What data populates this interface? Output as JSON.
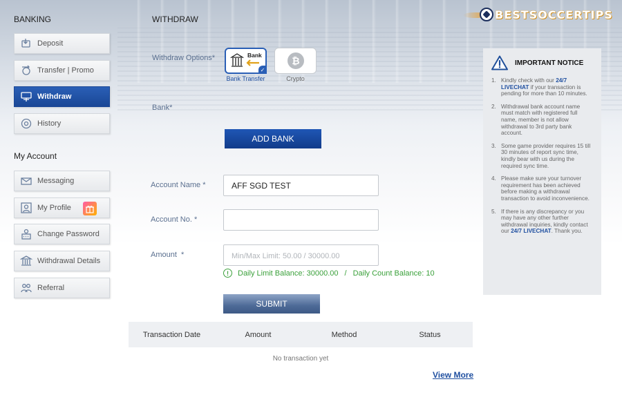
{
  "sidebar": {
    "banking_title": "BANKING",
    "banking_items": [
      {
        "label": "Deposit",
        "icon": "deposit-icon"
      },
      {
        "label": "Transfer | Promo",
        "icon": "transfer-icon"
      },
      {
        "label": "Withdraw",
        "icon": "withdraw-icon",
        "active": true
      },
      {
        "label": "History",
        "icon": "history-icon"
      }
    ],
    "account_title": "My Account",
    "account_items": [
      {
        "label": "Messaging",
        "icon": "envelope-icon"
      },
      {
        "label": "My Profile",
        "icon": "profile-icon",
        "badge": "gift-icon"
      },
      {
        "label": "Change Password",
        "icon": "password-icon"
      },
      {
        "label": "Withdrawal Details",
        "icon": "bank-icon"
      },
      {
        "label": "Referral",
        "icon": "referral-icon"
      }
    ]
  },
  "header": {
    "title": "WITHDRAW",
    "logo_text": "BESTSOCCERTIPS"
  },
  "form": {
    "withdraw_options_label": "Withdraw Options*",
    "options": [
      {
        "label": "Bank Transfer",
        "box_text": "Bank",
        "selected": true
      },
      {
        "label": "Crypto",
        "selected": false
      }
    ],
    "bank_label": "Bank*",
    "add_bank_label": "ADD BANK",
    "account_name_label": "Account Name *",
    "account_name_value": "AFF SGD TEST",
    "account_no_label": "Account No. *",
    "account_no_value": "",
    "amount_label": "Amount  *",
    "amount_placeholder": "Min/Max Limit: 50.00 / 30000.00",
    "daily_limit": "Daily Limit Balance: 30000.00",
    "separator": "/",
    "daily_count": "Daily Count Balance: 10",
    "submit_label": "SUBMIT"
  },
  "transactions": {
    "columns": [
      "Transaction Date",
      "Amount",
      "Method",
      "Status"
    ],
    "empty_text": "No transaction yet",
    "view_more": "View More"
  },
  "notice": {
    "title": "IMPORTANT NOTICE",
    "items": [
      {
        "num": "1.",
        "pre": "Kindly check with our ",
        "link": "24/7 LIVECHAT",
        "post": " if your transaction is pending for more than 10 minutes."
      },
      {
        "num": "2.",
        "text": "Withdrawal bank account name must match with registered full name, member is not allow withdrawal to 3rd party bank account."
      },
      {
        "num": "3.",
        "text": "Some game provider requires 15 till 30 minutes of report sync time, kindly bear with us during the required sync time."
      },
      {
        "num": "4.",
        "text": "Please make sure your turnover requirement has been achieved before making a withdrawal transaction to avoid inconvenience."
      },
      {
        "num": "5.",
        "pre": "If there is any discrepancy or you may have any other further withdrawal inquiries, kindly contact our ",
        "link": "24/7 LIVECHAT",
        "post": ". Thank you."
      }
    ]
  },
  "colors": {
    "accent": "#1f56b5",
    "active_nav": "#1a4796",
    "success": "#3aa03a",
    "link": "#1f4fa0",
    "logo_gold": "#d4911e"
  }
}
